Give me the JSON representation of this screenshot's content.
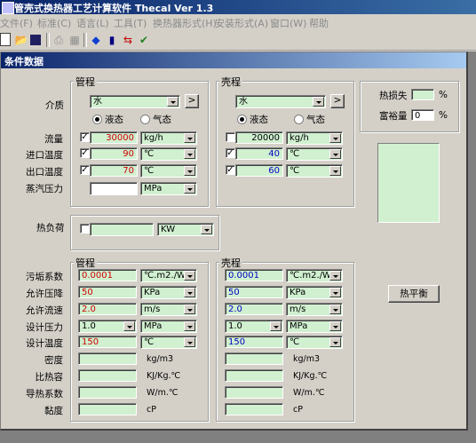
{
  "app": {
    "title": "管壳式换热器工艺计算软件 Thecal Ver 1.3"
  },
  "menu": [
    "文件(F)",
    "标准(C)",
    "语言(L)",
    "工具(T)",
    "换热器形式(H)",
    "安装形式(A)",
    "窗口(W)",
    "帮助"
  ],
  "child_window": {
    "title": "条件数据"
  },
  "upper": {
    "tube_group": "管程",
    "shell_group": "壳程",
    "medium_label": "介质",
    "tube_medium": "水",
    "shell_medium": "水",
    "more_button": ">",
    "liquid_label": "液态",
    "gas_label": "气态",
    "labels": {
      "flow": "流量",
      "inlet_temp": "进口温度",
      "outlet_temp": "出口温度",
      "steam_pressure": "蒸汽压力"
    },
    "tube": {
      "flow": "30000",
      "flow_unit": "kg/h",
      "inlet": "90",
      "inlet_unit": "℃",
      "outlet": "70",
      "outlet_unit": "℃",
      "steam": "",
      "steam_unit": "MPa"
    },
    "shell": {
      "flow": "20000",
      "flow_unit": "kg/h",
      "inlet": "40",
      "inlet_unit": "℃",
      "outlet": "60",
      "outlet_unit": "℃"
    }
  },
  "losses": {
    "heat_loss_label": "热损失",
    "heat_loss_value": "",
    "margin_label": "富裕量",
    "margin_value": "0",
    "pct": "%"
  },
  "heat_load": {
    "label": "热负荷",
    "value": "",
    "unit": "KW"
  },
  "lower": {
    "tube_group": "管程",
    "shell_group": "壳程",
    "labels": [
      "污垢系数",
      "允许压降",
      "允许流速",
      "设计压力",
      "设计温度",
      "密度",
      "比热容",
      "导热系数",
      "黏度"
    ],
    "tube": {
      "fouling": "0.0001",
      "fouling_unit": "℃.m2./W",
      "dp": "50",
      "dp_unit": "KPa",
      "velocity": "2.0",
      "velocity_unit": "m/s",
      "pressure": "1.0",
      "pressure_unit": "MPa",
      "temp": "150",
      "temp_unit": "℃",
      "density_unit": "kg/m3",
      "cp_unit": "KJ/Kg.℃",
      "k_unit": "W/m.℃",
      "visc_unit": "cP"
    },
    "shell": {
      "fouling": "0.0001",
      "fouling_unit": "℃.m2./W",
      "dp": "50",
      "dp_unit": "KPa",
      "velocity": "2.0",
      "velocity_unit": "m/s",
      "pressure": "1.0",
      "pressure_unit": "MPa",
      "temp": "150",
      "temp_unit": "℃",
      "density_unit": "kg/m3",
      "cp_unit": "KJ/Kg.℃",
      "k_unit": "W/m.℃",
      "visc_unit": "cP"
    }
  },
  "heat_balance_button": "热平衡"
}
